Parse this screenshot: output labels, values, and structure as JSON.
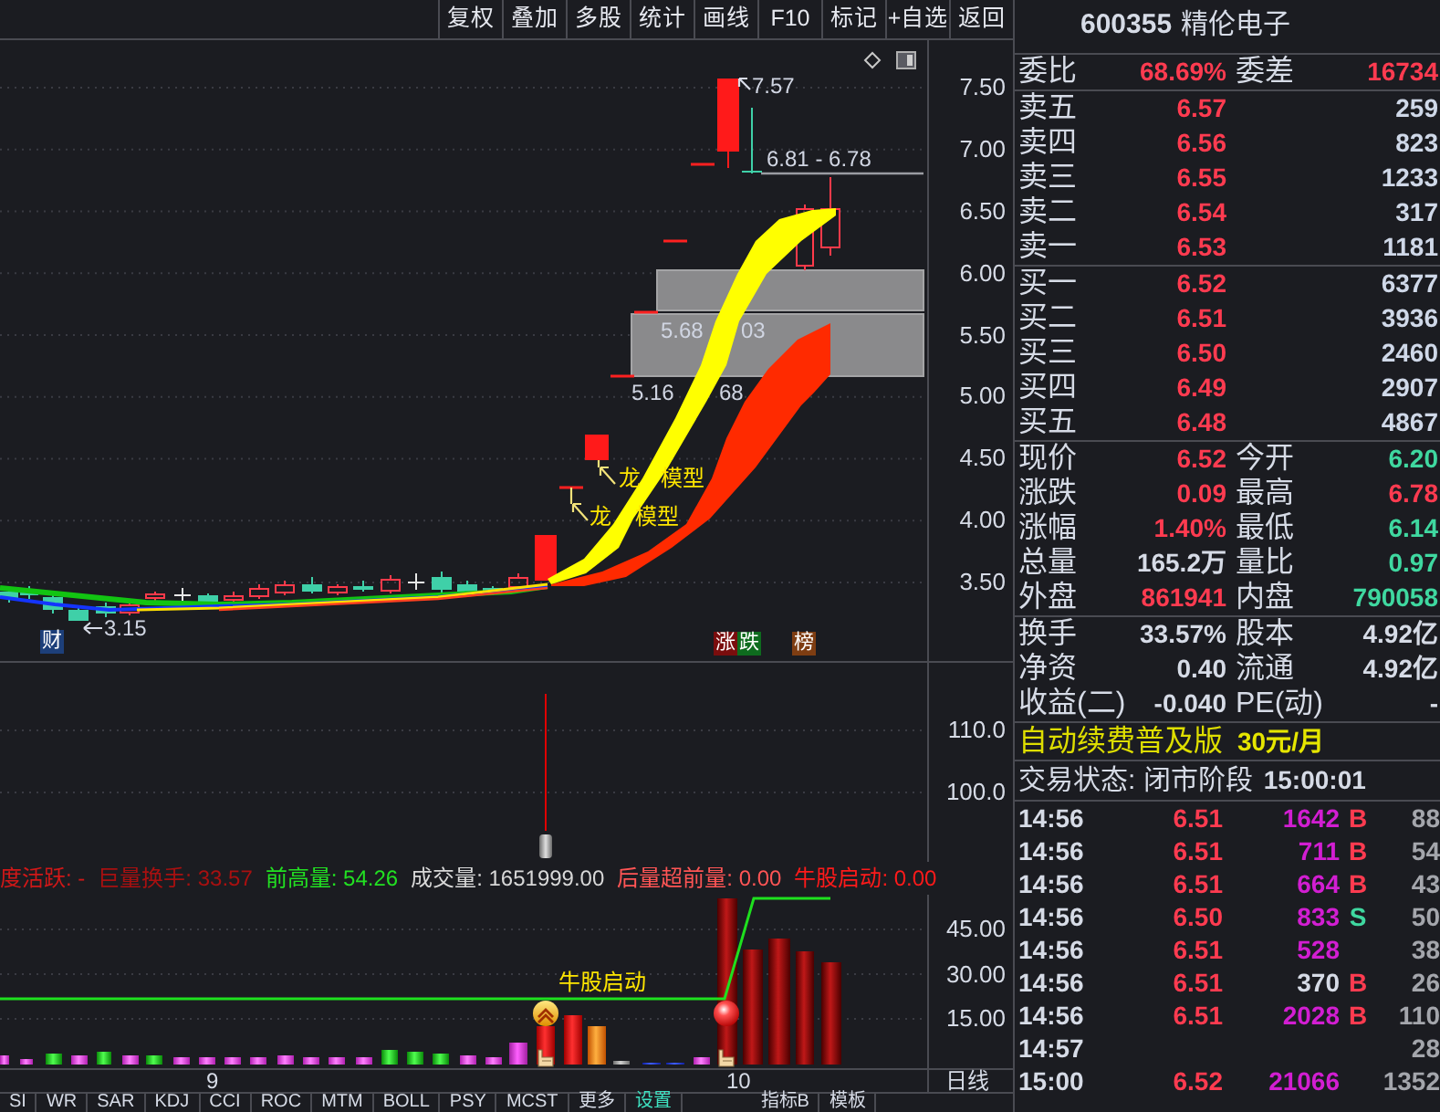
{
  "toolbar": {
    "buttons": [
      "复权",
      "叠加",
      "多股",
      "统计",
      "画线",
      "F10",
      "标记",
      "+自选",
      "返回"
    ]
  },
  "price_chart": {
    "axis_labels": [
      "7.50",
      "7.00",
      "6.50",
      "6.00",
      "5.50",
      "5.00",
      "4.50",
      "4.00",
      "3.50"
    ],
    "annotations": [
      {
        "kind": "high",
        "text": "7.57"
      },
      {
        "kind": "level",
        "text": "6.81 - 6.78"
      },
      {
        "kind": "zone",
        "parts": [
          "5.68",
          "03"
        ]
      },
      {
        "kind": "zone",
        "parts": [
          "5.16",
          "68"
        ]
      },
      {
        "kind": "low",
        "text": "3.15"
      }
    ],
    "signals": [
      {
        "parts": [
          "龙",
          "模型"
        ]
      },
      {
        "parts": [
          "龙",
          "模型"
        ]
      }
    ],
    "badges": [
      {
        "text": "财",
        "color": "#1d3f7a"
      },
      {
        "text": "涨",
        "color": "#7a0d0d"
      },
      {
        "text": "跌",
        "color": "#0e6b1e"
      },
      {
        "text": "榜",
        "color": "#7e3d12"
      }
    ]
  },
  "sub_chart": {
    "axis_labels": [
      "110.0",
      "100.0"
    ]
  },
  "volume_chart": {
    "legend": [
      {
        "text": "度活跃: -",
        "color": "#d01818"
      },
      {
        "text": "巨量换手: 33.57",
        "color": "#a81010"
      },
      {
        "text": "前高量: 54.26",
        "color": "#22e022"
      },
      {
        "text": "成交量: 1651999.00",
        "color": "#d8d8d8"
      },
      {
        "text": "后量超前量: 0.00",
        "color": "#ff5555"
      },
      {
        "text": "牛股启动: 0.00",
        "color": "#ff1a1a"
      }
    ],
    "axis_labels": [
      "45.00",
      "30.00",
      "15.00"
    ],
    "signal": "牛股启动"
  },
  "x_axis": {
    "labels": [
      "9",
      "10"
    ],
    "period": "日线"
  },
  "indicator_tabs": [
    {
      "label": "SI",
      "highlighted": false
    },
    {
      "label": "WR",
      "highlighted": false
    },
    {
      "label": "SAR",
      "highlighted": false
    },
    {
      "label": "KDJ",
      "highlighted": false
    },
    {
      "label": "CCI",
      "highlighted": false
    },
    {
      "label": "ROC",
      "highlighted": false
    },
    {
      "label": "MTM",
      "highlighted": false
    },
    {
      "label": "BOLL",
      "highlighted": false
    },
    {
      "label": "PSY",
      "highlighted": false
    },
    {
      "label": "MCST",
      "highlighted": false
    },
    {
      "label": "更多",
      "highlighted": false
    },
    {
      "label": "设置",
      "highlighted": true
    }
  ],
  "panel_tabs": [
    "指标B",
    "模板"
  ],
  "quote": {
    "code": "600355",
    "name": "精伦电子",
    "order_ratio": [
      {
        "label": "委比",
        "value": "68.69%"
      },
      {
        "label": "委差",
        "value": "16734"
      }
    ],
    "asks": [
      {
        "label": "卖五",
        "price": "6.57",
        "volume": "259"
      },
      {
        "label": "卖四",
        "price": "6.56",
        "volume": "823"
      },
      {
        "label": "卖三",
        "price": "6.55",
        "volume": "1233"
      },
      {
        "label": "卖二",
        "price": "6.54",
        "volume": "317"
      },
      {
        "label": "卖一",
        "price": "6.53",
        "volume": "1181"
      }
    ],
    "bids": [
      {
        "label": "买一",
        "price": "6.52",
        "volume": "6377"
      },
      {
        "label": "买二",
        "price": "6.51",
        "volume": "3936"
      },
      {
        "label": "买三",
        "price": "6.50",
        "volume": "2460"
      },
      {
        "label": "买四",
        "price": "6.49",
        "volume": "2907"
      },
      {
        "label": "买五",
        "price": "6.48",
        "volume": "4867"
      }
    ],
    "stats": [
      {
        "label": "现价",
        "value": "6.52",
        "color": "#ff3b50"
      },
      {
        "label": "今开",
        "value": "6.20",
        "color": "#3fd8a0"
      },
      {
        "label": "涨跌",
        "value": "0.09",
        "color": "#ff3b50"
      },
      {
        "label": "最高",
        "value": "6.78",
        "color": "#ff3b50"
      },
      {
        "label": "涨幅",
        "value": "1.40%",
        "color": "#ff3b50"
      },
      {
        "label": "最低",
        "value": "6.14",
        "color": "#3fd8a0"
      },
      {
        "label": "总量",
        "value": "165.2万",
        "color": "#d6dbe6"
      },
      {
        "label": "量比",
        "value": "0.97",
        "color": "#3fd8a0"
      },
      {
        "label": "外盘",
        "value": "861941",
        "color": "#ff3b50"
      },
      {
        "label": "内盘",
        "value": "790058",
        "color": "#3fd8a0"
      }
    ],
    "fundamentals": [
      {
        "label": "换手",
        "value": "33.57%"
      },
      {
        "label": "股本",
        "value": "4.92亿"
      },
      {
        "label": "净资",
        "value": "0.40"
      },
      {
        "label": "流通",
        "value": "4.92亿"
      },
      {
        "label": "收益(二)",
        "value": "-0.040"
      },
      {
        "label": "PE(动)",
        "value": "-"
      }
    ],
    "promo": {
      "text": "自动续费普及版",
      "price": "30元/月"
    },
    "market_status": {
      "text": "交易状态: 闭市阶段",
      "time": "15:00:01"
    },
    "trades": [
      {
        "time": "14:56",
        "price": "6.51",
        "volume": "1642",
        "big": true,
        "kind": "buy",
        "side": "B",
        "count": "88"
      },
      {
        "time": "14:56",
        "price": "6.51",
        "volume": "711",
        "big": true,
        "kind": "buy",
        "side": "B",
        "count": "54"
      },
      {
        "time": "14:56",
        "price": "6.51",
        "volume": "664",
        "big": true,
        "kind": "buy",
        "side": "B",
        "count": "43"
      },
      {
        "time": "14:56",
        "price": "6.50",
        "volume": "833",
        "big": true,
        "kind": "sell",
        "side": "S",
        "count": "50"
      },
      {
        "time": "14:56",
        "price": "6.51",
        "volume": "528",
        "big": true,
        "kind": "neutral",
        "count": "38"
      },
      {
        "time": "14:56",
        "price": "6.51",
        "volume": "370",
        "big": false,
        "kind": "buy",
        "side": "B",
        "count": "26"
      },
      {
        "time": "14:56",
        "price": "6.51",
        "volume": "2028",
        "big": true,
        "kind": "buy",
        "side": "B",
        "count": "110"
      },
      {
        "time": "14:57",
        "kind": "neutral",
        "count": "28"
      },
      {
        "time": "15:00",
        "price": "6.52",
        "volume": "21066",
        "big": true,
        "kind": "neutral",
        "count": "1352"
      }
    ]
  }
}
